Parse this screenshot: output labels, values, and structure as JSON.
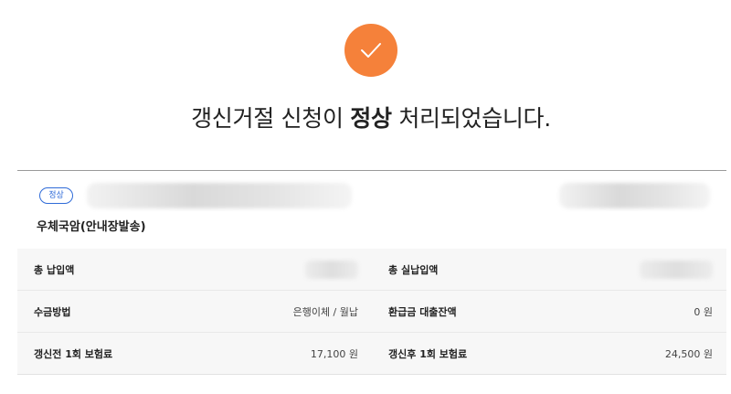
{
  "status": {
    "headline_pre": "갱신거절 신청이 ",
    "headline_bold": "정상",
    "headline_post": " 처리되었습니다.",
    "accent_color": "#f5813a",
    "icon": "check-icon"
  },
  "contract": {
    "badge": "정상",
    "badge_color": "#2f6bd8",
    "product": "우체국암(안내장발송)"
  },
  "details": {
    "rows": [
      {
        "left_label": "총 납입액",
        "left_value": "",
        "right_label": "총 실납입액",
        "right_value": ""
      },
      {
        "left_label": "수금방법",
        "left_value": "은행이체 / 월납",
        "right_label": "환급금 대출잔액",
        "right_value": "0 원"
      },
      {
        "left_label": "갱신전 1회 보험료",
        "left_value": "17,100 원",
        "right_label": "갱신후 1회 보험료",
        "right_value": "24,500 원"
      }
    ]
  }
}
